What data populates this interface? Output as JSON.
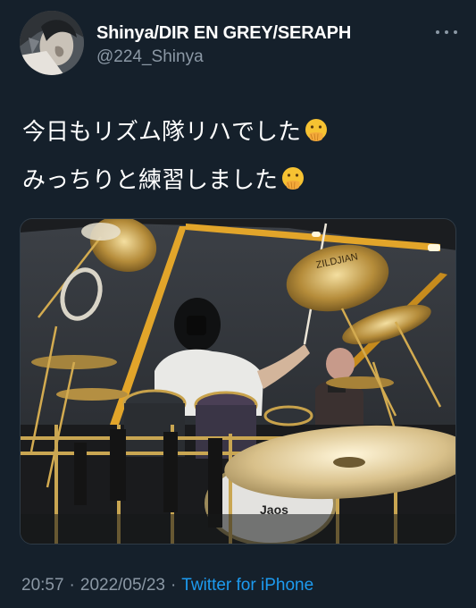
{
  "tweet": {
    "display_name": "Shinya/DIR EN GREY/SERAPH",
    "handle": "@224_Shinya",
    "lines": [
      "今日もリズム隊リハでした",
      "みっちりと練習しました"
    ],
    "emoji": "face-with-hand-over-mouth-emoji",
    "time": "20:57",
    "separator": "·",
    "date": "2022/05/23",
    "source": "Twitter for iPhone"
  },
  "media": {
    "description_icon": "photo-drummer-at-drum-kit",
    "cymbal_brand_text": "ZILDJIAN",
    "bass_drum_text": "Jaos"
  },
  "colors": {
    "background": "#15202b",
    "primary_text": "#ffffff",
    "secondary_text": "#8b98a5",
    "link": "#1d9bf0",
    "emoji_yellow": "#f6c232"
  }
}
